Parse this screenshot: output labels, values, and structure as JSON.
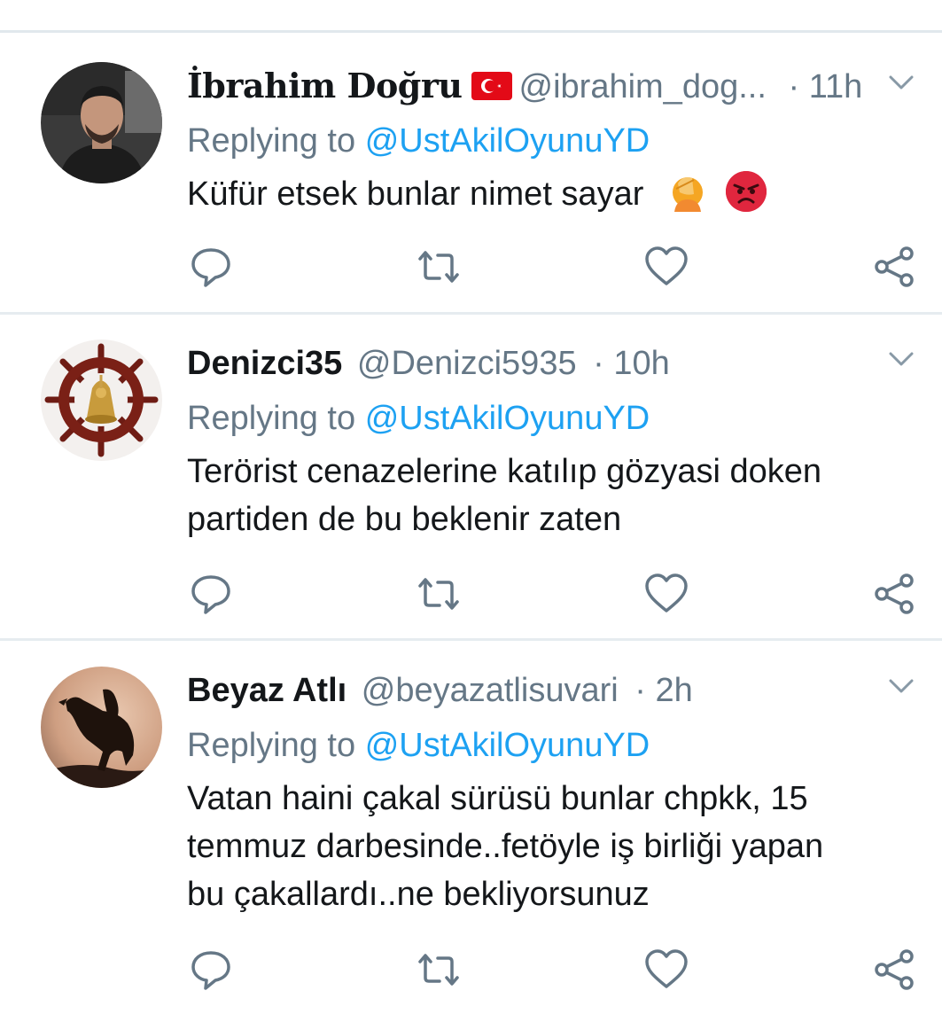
{
  "tweets": [
    {
      "name": "İbrahim Doğru",
      "handle": "@ibrahim_dog...",
      "separator": "·",
      "time": "11h",
      "replying_label": "Replying to",
      "replying_to": "@UstAkilOyunuYD",
      "text": "Küfür etsek bunlar nimet sayar",
      "emojis": [
        "face-palm-emoji",
        "angry-face-emoji"
      ],
      "flag": "turkey-flag-icon"
    },
    {
      "name": "Denizci35",
      "handle": "@Denizci5935",
      "separator": "·",
      "time": "10h",
      "replying_label": "Replying to",
      "replying_to": "@UstAkilOyunuYD",
      "text_lines": [
        "Terörist cenazelerine katılıp gözyasi doken",
        "partiden de bu beklenir zaten"
      ]
    },
    {
      "name": "Beyaz Atlı",
      "handle": "@beyazatlisuvari",
      "separator": "·",
      "time": "2h",
      "replying_label": "Replying to",
      "replying_to": "@UstAkilOyunuYD",
      "text_lines": [
        "Vatan haini çakal sürüsü bunlar chpkk, 15",
        "temmuz darbesinde..fetöyle iş birliği yapan",
        "bu çakallardı..ne bekliyorsunuz"
      ]
    }
  ],
  "icons": {
    "reply": "reply-icon",
    "retweet": "retweet-icon",
    "like": "heart-icon",
    "share": "share-icon",
    "more": "chevron-down-icon"
  },
  "colors": {
    "link": "#1da1f2",
    "muted": "#657786",
    "text": "#14171a",
    "divider": "#e6ecf0"
  }
}
